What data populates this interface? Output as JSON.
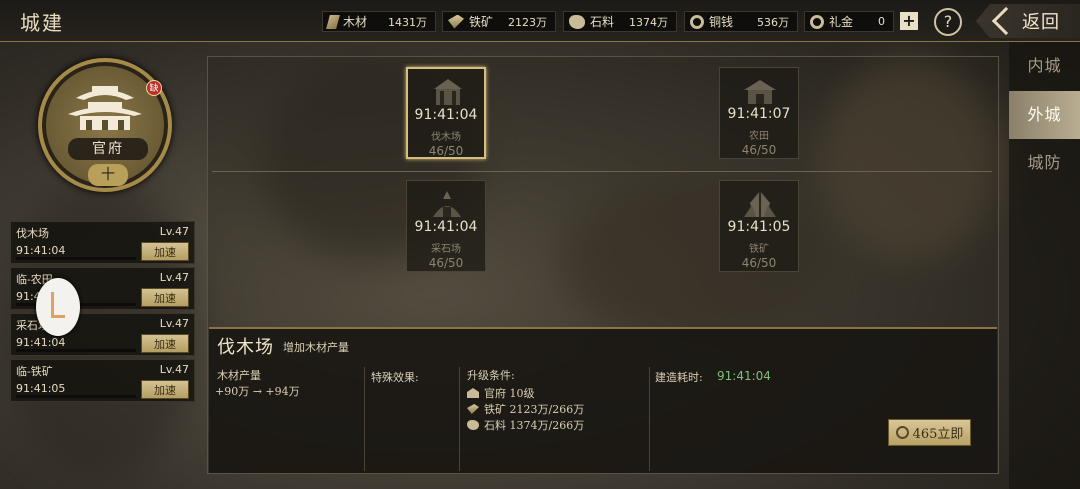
{
  "header": {
    "title": "城建"
  },
  "resources": [
    {
      "icon": "wood-icon",
      "name": "木材",
      "value": "1431万"
    },
    {
      "icon": "iron-icon",
      "name": "铁矿",
      "value": "2123万"
    },
    {
      "icon": "stone-icon",
      "name": "石料",
      "value": "1374万"
    },
    {
      "icon": "copper-coin-icon",
      "name": "铜钱",
      "value": "536万"
    },
    {
      "icon": "gift-coin-icon",
      "name": "礼金",
      "value": "0"
    }
  ],
  "buttons": {
    "plus": "+",
    "help": "?",
    "back": "返回"
  },
  "palace": {
    "name": "官府",
    "level": "十",
    "badge": "缺"
  },
  "queue": [
    {
      "name": "伐木场",
      "level": "Lv.47",
      "time": "91:41:04",
      "button": "加速"
    },
    {
      "name": "临-农田",
      "level": "Lv.47",
      "time": "91:41:04",
      "button": "加速"
    },
    {
      "name": "采石场",
      "level": "Lv.47",
      "time": "91:41:04",
      "button": "加速"
    },
    {
      "name": "临-铁矿",
      "level": "Lv.47",
      "time": "91:41:05",
      "button": "加速"
    }
  ],
  "buildings": [
    {
      "name": "伐木场",
      "time": "91:41:04",
      "progress": "46/50",
      "icon": "lumber-mill-icon",
      "selected": true
    },
    {
      "name": "农田",
      "time": "91:41:07",
      "progress": "46/50",
      "icon": "farm-icon",
      "selected": false
    },
    {
      "name": "采石场",
      "time": "91:41:04",
      "progress": "46/50",
      "icon": "quarry-icon",
      "selected": false
    },
    {
      "name": "铁矿",
      "time": "91:41:05",
      "progress": "46/50",
      "icon": "iron-mine-icon",
      "selected": false
    }
  ],
  "detail": {
    "title": "伐木场",
    "subtitle": "增加木材产量",
    "output_label": "木材产量",
    "output_change": "+90万 → +94万",
    "special_label": "特殊效果:",
    "requirements_label": "升级条件:",
    "requirements": [
      {
        "icon": "palace-icon",
        "text": "官府 10级"
      },
      {
        "icon": "iron-icon",
        "text": "铁矿 2123万/266万"
      },
      {
        "icon": "stone-icon",
        "text": "石料 1374万/266万"
      }
    ],
    "build_time_label": "建造耗时:",
    "build_time": "91:41:04",
    "instant_button": "465立即"
  },
  "tabs": [
    {
      "label": "内城",
      "active": false
    },
    {
      "label": "外城",
      "active": true
    },
    {
      "label": "城防",
      "active": false
    }
  ]
}
